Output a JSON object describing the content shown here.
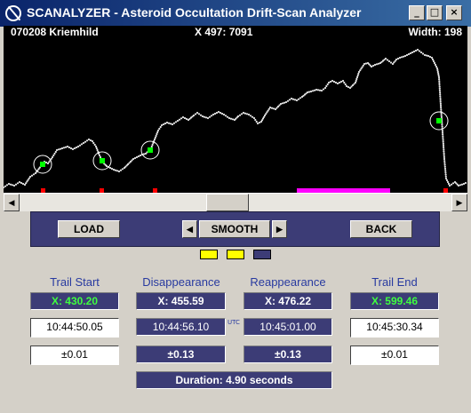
{
  "window": {
    "title": "SCANALYZER - Asteroid Occultation Drift-Scan Analyzer",
    "minimize_glyph": "_",
    "maximize_glyph": "□",
    "close_glyph": "×"
  },
  "plot_header": {
    "target": "070208 Kriemhild",
    "cursor": "X 497: 7091",
    "width": "Width: 198"
  },
  "trace_color": "#e6e6e6",
  "marker_color": "#00ff00",
  "magenta_color": "#ff00ff",
  "red_marker_color": "#ff0000",
  "scrollbar": {
    "left_glyph": "◀",
    "right_glyph": "▶",
    "position_fraction": 0.48
  },
  "toolbar": {
    "load_label": "LOAD",
    "smooth_label": "SMOOTH",
    "smooth_left_glyph": "◀",
    "smooth_right_glyph": "▶",
    "back_label": "BACK"
  },
  "swatches": [
    "#ffff00",
    "#ffff00",
    "#3c3c76"
  ],
  "columns": {
    "trail_start": {
      "title": "Trail Start",
      "x": "X:  430.20",
      "time": "10:44:50.05",
      "err": "±0.01"
    },
    "disappearance": {
      "title": "Disappearance",
      "x": "X:  455.59",
      "time": "10:44:56.10",
      "err": "±0.13"
    },
    "reappearance": {
      "title": "Reappearance",
      "x": "X:  476.22",
      "time": "10:45:01.00",
      "err": "±0.13"
    },
    "trail_end": {
      "title": "Trail End",
      "x": "X:  599.46",
      "time": "10:45:30.34",
      "err": "±0.01"
    }
  },
  "utc_label": "UTC",
  "duration": "Duration:  4.90  seconds",
  "trace": {
    "x_range": [
      0,
      522
    ],
    "y_range": [
      0,
      188
    ],
    "points": [
      [
        0,
        182
      ],
      [
        6,
        178
      ],
      [
        12,
        180
      ],
      [
        18,
        176
      ],
      [
        24,
        179
      ],
      [
        30,
        170
      ],
      [
        36,
        166
      ],
      [
        42,
        158
      ],
      [
        46,
        153
      ],
      [
        50,
        155
      ],
      [
        55,
        148
      ],
      [
        60,
        140
      ],
      [
        66,
        138
      ],
      [
        72,
        136
      ],
      [
        78,
        139
      ],
      [
        84,
        136
      ],
      [
        90,
        132
      ],
      [
        96,
        128
      ],
      [
        100,
        130
      ],
      [
        104,
        136
      ],
      [
        108,
        146
      ],
      [
        112,
        154
      ],
      [
        116,
        158
      ],
      [
        120,
        160
      ],
      [
        124,
        162
      ],
      [
        130,
        164
      ],
      [
        136,
        160
      ],
      [
        140,
        156
      ],
      [
        146,
        150
      ],
      [
        152,
        147
      ],
      [
        156,
        145
      ],
      [
        160,
        144
      ],
      [
        166,
        138
      ],
      [
        170,
        128
      ],
      [
        174,
        118
      ],
      [
        178,
        112
      ],
      [
        184,
        109
      ],
      [
        190,
        111
      ],
      [
        196,
        107
      ],
      [
        202,
        103
      ],
      [
        208,
        106
      ],
      [
        214,
        101
      ],
      [
        218,
        98
      ],
      [
        224,
        102
      ],
      [
        230,
        104
      ],
      [
        236,
        100
      ],
      [
        242,
        97
      ],
      [
        248,
        100
      ],
      [
        254,
        104
      ],
      [
        260,
        106
      ],
      [
        264,
        102
      ],
      [
        270,
        98
      ],
      [
        276,
        100
      ],
      [
        282,
        104
      ],
      [
        286,
        110
      ],
      [
        290,
        108
      ],
      [
        294,
        101
      ],
      [
        300,
        92
      ],
      [
        306,
        94
      ],
      [
        312,
        88
      ],
      [
        318,
        86
      ],
      [
        324,
        82
      ],
      [
        330,
        84
      ],
      [
        336,
        80
      ],
      [
        342,
        75
      ],
      [
        346,
        74
      ],
      [
        352,
        72
      ],
      [
        358,
        73
      ],
      [
        362,
        70
      ],
      [
        366,
        64
      ],
      [
        370,
        62
      ],
      [
        376,
        65
      ],
      [
        382,
        62
      ],
      [
        386,
        68
      ],
      [
        390,
        70
      ],
      [
        396,
        64
      ],
      [
        400,
        52
      ],
      [
        406,
        43
      ],
      [
        410,
        42
      ],
      [
        414,
        46
      ],
      [
        418,
        44
      ],
      [
        424,
        42
      ],
      [
        430,
        37
      ],
      [
        434,
        40
      ],
      [
        438,
        43
      ],
      [
        442,
        38
      ],
      [
        446,
        36
      ],
      [
        452,
        34
      ],
      [
        458,
        31
      ],
      [
        462,
        29
      ],
      [
        466,
        27
      ],
      [
        470,
        30
      ],
      [
        474,
        33
      ],
      [
        478,
        34
      ],
      [
        482,
        36
      ],
      [
        484,
        40
      ],
      [
        486,
        44
      ],
      [
        488,
        48
      ],
      [
        490,
        58
      ],
      [
        492,
        90
      ],
      [
        494,
        120
      ],
      [
        496,
        150
      ],
      [
        498,
        172
      ],
      [
        502,
        180
      ],
      [
        508,
        176
      ],
      [
        512,
        180
      ],
      [
        518,
        178
      ],
      [
        522,
        176
      ]
    ]
  },
  "circle_markers": [
    [
      44,
      156
    ],
    [
      111,
      152
    ],
    [
      165,
      140
    ],
    [
      490,
      107
    ]
  ],
  "red_markers": [
    44,
    110,
    170,
    497
  ],
  "magenta_span": [
    330,
    435
  ]
}
